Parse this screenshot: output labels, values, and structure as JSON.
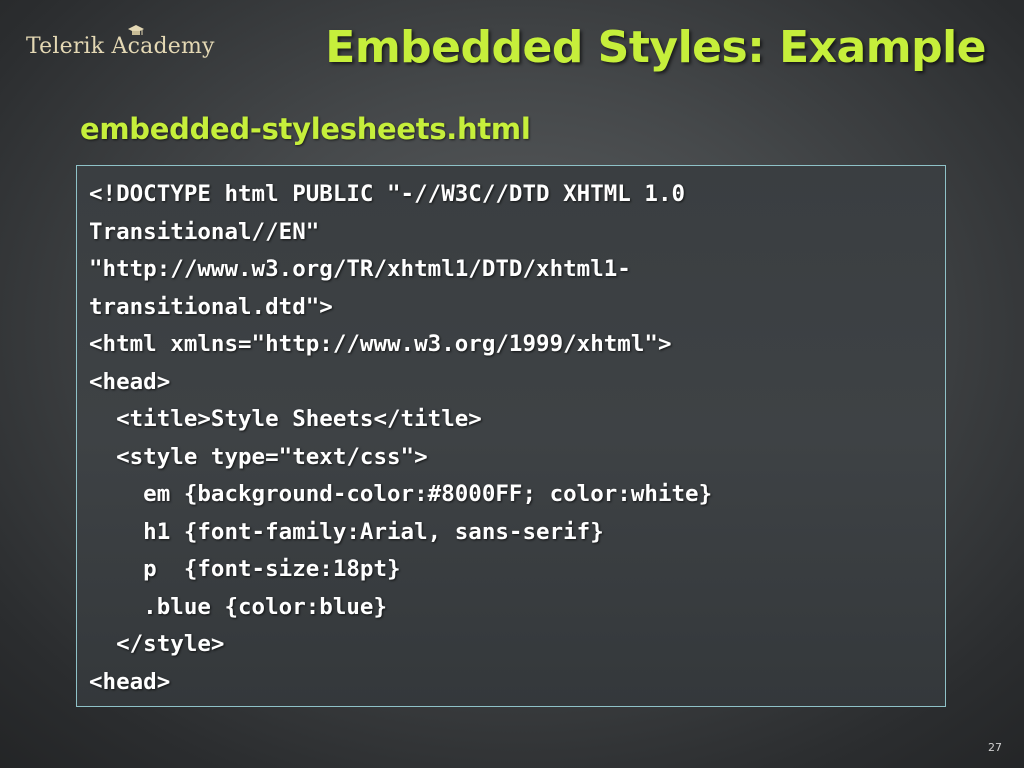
{
  "logo": {
    "text": "Telerik Academy"
  },
  "slide": {
    "title": "Embedded Styles: Example",
    "subtitle": "embedded-stylesheets.html",
    "page_number": "27"
  },
  "code": {
    "lines": [
      "<!DOCTYPE html PUBLIC \"-//W3C//DTD XHTML 1.0",
      "Transitional//EN\"",
      "\"http://www.w3.org/TR/xhtml1/DTD/xhtml1-",
      "transitional.dtd\">",
      "<html xmlns=\"http://www.w3.org/1999/xhtml\">",
      "<head>",
      "  <title>Style Sheets</title>",
      "  <style type=\"text/css\">",
      "    em {background-color:#8000FF; color:white}",
      "    h1 {font-family:Arial, sans-serif}",
      "    p  {font-size:18pt}",
      "    .blue {color:blue}",
      "  </style>",
      "<head>"
    ]
  },
  "colors": {
    "accent": "#c6ef3b",
    "code_border": "#8fc2c8",
    "logo": "#e4d8b4"
  }
}
